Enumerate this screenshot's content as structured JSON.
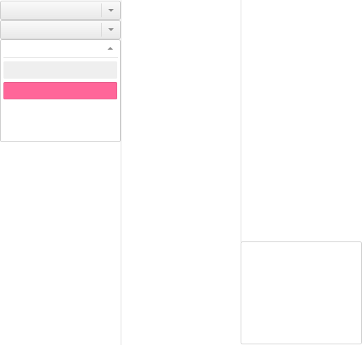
{
  "dropdowns": [
    {
      "selected_value": ""
    },
    {
      "selected_value": ""
    }
  ],
  "open_dropdown": {
    "selected_value": "",
    "options": [
      {
        "label": ""
      },
      {
        "label": ""
      }
    ]
  },
  "colors": {
    "highlight": "#ff6699",
    "hover": "#efefef",
    "border": "#c9c9c9"
  }
}
